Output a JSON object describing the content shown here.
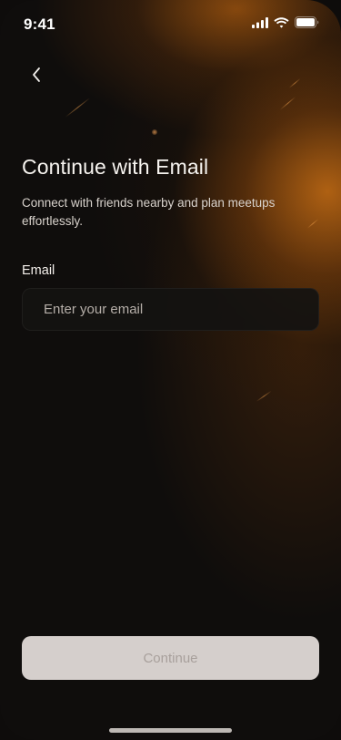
{
  "status_bar": {
    "time": "9:41",
    "icons": [
      "cellular-signal-icon",
      "wifi-icon",
      "battery-icon"
    ]
  },
  "nav": {
    "back_icon": "chevron-left-icon"
  },
  "header": {
    "title": "Continue with Email",
    "subtitle": "Connect with friends nearby and plan meetups effortlessly."
  },
  "form": {
    "email_label": "Email",
    "email_value": "",
    "email_placeholder": "Enter your email"
  },
  "actions": {
    "continue_label": "Continue",
    "continue_enabled": false
  },
  "colors": {
    "background": "#0f0d0c",
    "accent_glow": "#c86e14",
    "button_disabled_bg": "#d5cfcc",
    "button_disabled_text": "#a8a09c"
  }
}
